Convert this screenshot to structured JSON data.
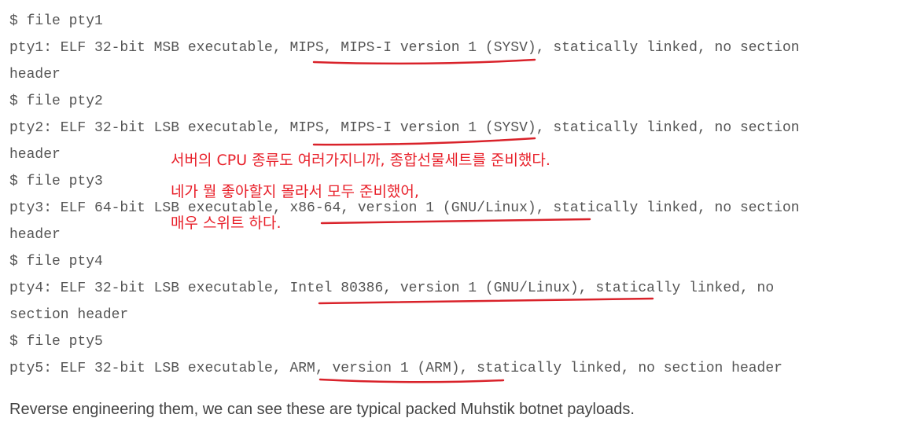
{
  "code_lines": [
    "$ file pty1",
    "pty1: ELF 32-bit MSB executable, MIPS, MIPS-I version 1 (SYSV), statically linked, no section",
    "header",
    "$ file pty2",
    "pty2: ELF 32-bit LSB executable, MIPS, MIPS-I version 1 (SYSV), statically linked, no section",
    "header",
    "$ file pty3",
    "pty3: ELF 64-bit LSB executable, x86-64, version 1 (GNU/Linux), statically linked, no section",
    "header",
    "$ file pty4",
    "pty4: ELF 32-bit LSB executable, Intel 80386, version 1 (GNU/Linux), statically linked, no",
    "section header",
    "$ file pty5",
    "pty5: ELF 32-bit LSB executable, ARM, version 1 (ARM), statically linked, no section header"
  ],
  "annotations": {
    "line1": "서버의 CPU 종류도 여러가지니까, 종합선물세트를 준비했다.",
    "line2": "네가 뭘 좋아할지 몰라서 모두 준비했어,",
    "line3": "매우 스위트 하다."
  },
  "prose": "Reverse engineering them, we can see these are typical packed Muhstik botnet payloads.",
  "colors": {
    "code_text": "#555555",
    "annotation": "#e8202a",
    "underline": "#d9222a",
    "prose_text": "#444444"
  }
}
